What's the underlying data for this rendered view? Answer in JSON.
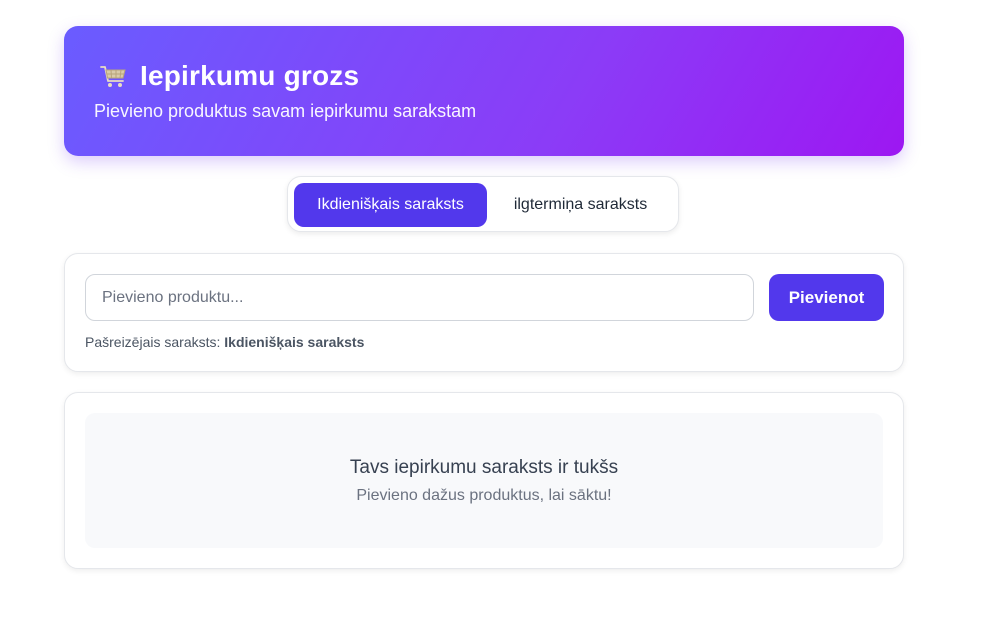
{
  "header": {
    "icon": "shopping-cart-icon",
    "title": "Iepirkumu grozs",
    "subtitle": "Pievieno produktus savam iepirkumu sarakstam",
    "gradient_start": "#6a5cff",
    "gradient_end": "#9d17f2"
  },
  "tabs": [
    {
      "label": "Ikdienišķais saraksts",
      "active": true
    },
    {
      "label": "ilgtermiņa saraksts",
      "active": false
    }
  ],
  "add_form": {
    "input_placeholder": "Pievieno produktu...",
    "input_value": "",
    "button_label": "Pievienot",
    "current_list_prefix": "Pašreizējais saraksts:",
    "current_list_name": "Ikdienišķais saraksts"
  },
  "list": {
    "empty_title": "Tavs iepirkumu saraksts ir tukšs",
    "empty_subtitle": "Pievieno dažus produktus, lai sāktu!"
  },
  "colors": {
    "accent": "#5238ec"
  }
}
